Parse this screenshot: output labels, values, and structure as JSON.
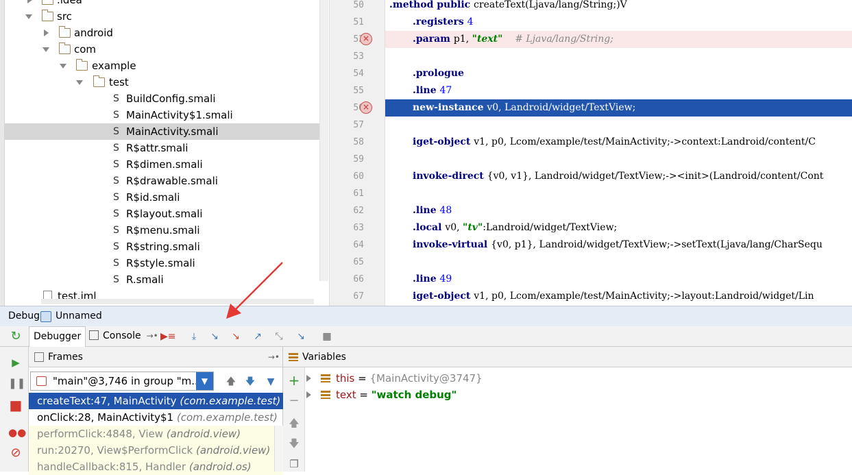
{
  "project_tree": {
    "items": [
      {
        "label": ".idea",
        "kind": "folder",
        "state": "collapsed",
        "depth": 1
      },
      {
        "label": "src",
        "kind": "folder",
        "state": "expanded",
        "depth": 1
      },
      {
        "label": "android",
        "kind": "folder",
        "state": "collapsed",
        "depth": 2
      },
      {
        "label": "com",
        "kind": "folder",
        "state": "expanded",
        "depth": 2
      },
      {
        "label": "example",
        "kind": "folder",
        "state": "expanded",
        "depth": 3
      },
      {
        "label": "test",
        "kind": "folder",
        "state": "expanded",
        "depth": 4
      },
      {
        "label": "BuildConfig.smali",
        "kind": "smali"
      },
      {
        "label": "MainActivity$1.smali",
        "kind": "smali"
      },
      {
        "label": "MainActivity.smali",
        "kind": "smali",
        "selected": true
      },
      {
        "label": "R$attr.smali",
        "kind": "smali"
      },
      {
        "label": "R$dimen.smali",
        "kind": "smali"
      },
      {
        "label": "R$drawable.smali",
        "kind": "smali"
      },
      {
        "label": "R$id.smali",
        "kind": "smali"
      },
      {
        "label": "R$layout.smali",
        "kind": "smali"
      },
      {
        "label": "R$menu.smali",
        "kind": "smali"
      },
      {
        "label": "R$string.smali",
        "kind": "smali"
      },
      {
        "label": "R$style.smali",
        "kind": "smali"
      },
      {
        "label": "R.smali",
        "kind": "smali"
      },
      {
        "label": "test.iml",
        "kind": "iml"
      }
    ],
    "smali_glyph": "S"
  },
  "editor": {
    "lines": [
      {
        "n": "50",
        "parts": [
          {
            "t": ".method public ",
            "c": "kw"
          },
          {
            "t": "createText(Ljava/lang/String;)V",
            "c": ""
          }
        ],
        "indent": 0
      },
      {
        "n": "51",
        "parts": [
          {
            "t": ".registers ",
            "c": "kw"
          },
          {
            "t": "4",
            "c": "num"
          }
        ]
      },
      {
        "n": "52",
        "parts": [
          {
            "t": ".param ",
            "c": "kw"
          },
          {
            "t": "p1, ",
            "c": ""
          },
          {
            "t": "\"text\"",
            "c": "str"
          },
          {
            "t": "    # Ljava/lang/String;",
            "c": "cmt"
          }
        ],
        "breakpoint": true
      },
      {
        "n": "53",
        "parts": []
      },
      {
        "n": "54",
        "parts": [
          {
            "t": ".prologue",
            "c": "kw"
          }
        ]
      },
      {
        "n": "55",
        "parts": [
          {
            "t": ".line ",
            "c": "kw"
          },
          {
            "t": "47",
            "c": "num"
          }
        ]
      },
      {
        "n": "56",
        "parts": [
          {
            "t": "new-instance ",
            "c": "kw"
          },
          {
            "t": "v0, Landroid/widget/TextView;",
            "c": ""
          }
        ],
        "breakpoint": true,
        "current": true
      },
      {
        "n": "57",
        "parts": []
      },
      {
        "n": "58",
        "parts": [
          {
            "t": "iget-object ",
            "c": "kw"
          },
          {
            "t": "v1, p0, Lcom/example/test/MainActivity;->context:Landroid/content/C",
            "c": ""
          }
        ]
      },
      {
        "n": "59",
        "parts": []
      },
      {
        "n": "60",
        "parts": [
          {
            "t": "invoke-direct ",
            "c": "kw"
          },
          {
            "t": "{v0, v1}, Landroid/widget/TextView;-><init>(Landroid/content/Cont",
            "c": ""
          }
        ]
      },
      {
        "n": "61",
        "parts": []
      },
      {
        "n": "62",
        "parts": [
          {
            "t": ".line ",
            "c": "kw"
          },
          {
            "t": "48",
            "c": "num"
          }
        ]
      },
      {
        "n": "63",
        "parts": [
          {
            "t": ".local ",
            "c": "kw"
          },
          {
            "t": "v0, ",
            "c": ""
          },
          {
            "t": "\"tv\"",
            "c": "str"
          },
          {
            "t": ":Landroid/widget/TextView;",
            "c": ""
          }
        ]
      },
      {
        "n": "64",
        "parts": [
          {
            "t": "invoke-virtual ",
            "c": "kw"
          },
          {
            "t": "{v0, p1}, Landroid/widget/TextView;->setText(Ljava/lang/CharSequ",
            "c": ""
          }
        ]
      },
      {
        "n": "65",
        "parts": []
      },
      {
        "n": "66",
        "parts": [
          {
            "t": ".line ",
            "c": "kw"
          },
          {
            "t": "49",
            "c": "num"
          }
        ]
      },
      {
        "n": "67",
        "parts": [
          {
            "t": "iget-object ",
            "c": "kw"
          },
          {
            "t": "v1, p0, Lcom/example/test/MainActivity;->layout:Landroid/widget/Lin",
            "c": ""
          }
        ]
      }
    ]
  },
  "debug": {
    "title": "Debug",
    "config_name": "Unnamed",
    "tabs": {
      "debugger": "Debugger",
      "console": "Console"
    },
    "frames_title": "Frames",
    "variables_title": "Variables",
    "thread_select": "\"main\"@3,746 in group \"m...",
    "frames": [
      {
        "method": "createText:47, MainActivity",
        "pkg": "(com.example.test)",
        "state": "selected"
      },
      {
        "method": "onClick:28, MainActivity$1",
        "pkg": "(com.example.test)",
        "state": "normal"
      },
      {
        "method": "performClick:4848, View",
        "pkg": "(android.view)",
        "state": "library"
      },
      {
        "method": "run:20270, View$PerformClick",
        "pkg": "(android.view)",
        "state": "library"
      },
      {
        "method": "handleCallback:815, Handler",
        "pkg": "(android.os)",
        "state": "library"
      }
    ],
    "variables": [
      {
        "name": "this",
        "eq": " = ",
        "value": "{MainActivity@3747}",
        "type": "object"
      },
      {
        "name": "text",
        "eq": " = ",
        "value": "\"watch debug\"",
        "type": "string"
      }
    ]
  },
  "colors": {
    "selection": "#2154ad",
    "breakpoint": "#c75450",
    "annotation_arrow": "#e53935"
  }
}
